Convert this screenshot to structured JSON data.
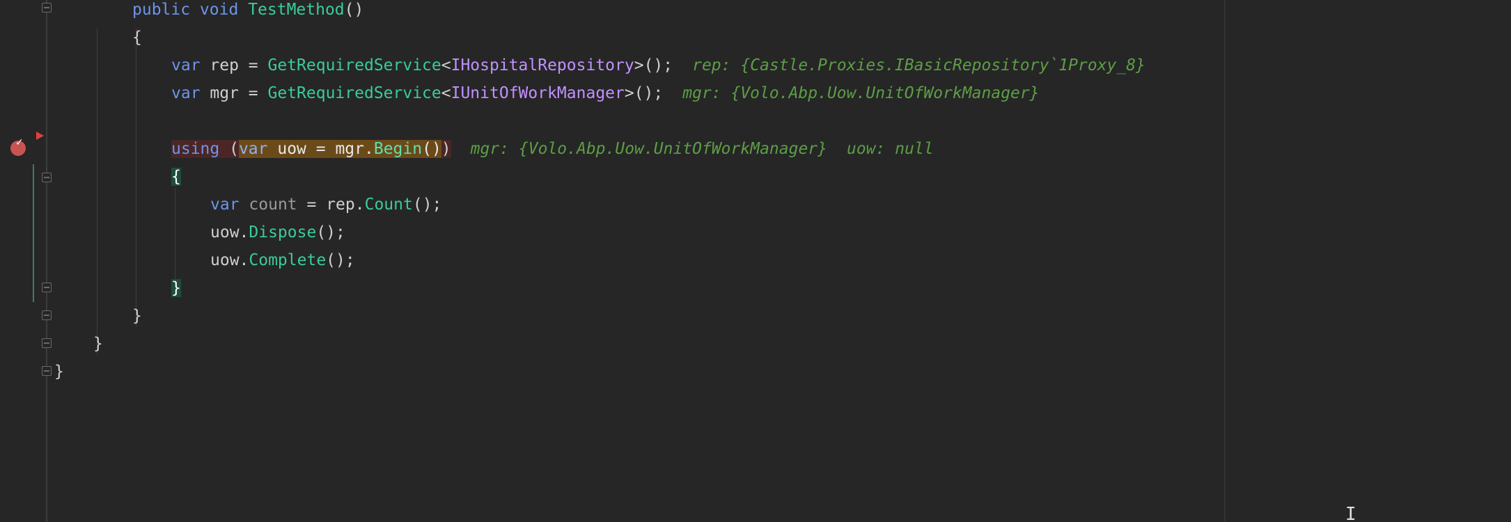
{
  "code": {
    "method_modifiers": "public void",
    "method_name": "TestMethod",
    "method_parens": "()",
    "open_brace": "{",
    "close_brace": "}",
    "kw_var": "var",
    "kw_using": "using",
    "rep_decl": {
      "name": "rep",
      "assign": " = ",
      "call": "GetRequiredService",
      "type_open": "<",
      "type": "IHospitalRepository",
      "type_close": ">();",
      "hint": "rep: {Castle.Proxies.IBasicRepository`1Proxy_8}"
    },
    "mgr_decl": {
      "name": "mgr",
      "assign": " = ",
      "call": "GetRequiredService",
      "type_open": "<",
      "type": "IUnitOfWorkManager",
      "type_close": ">();",
      "hint": "mgr: {Volo.Abp.Uow.UnitOfWorkManager}"
    },
    "using_stmt": {
      "open_paren": " (",
      "decl": "uow = mgr.",
      "call": "Begin",
      "call_parens": "()",
      "close_paren": ")",
      "hint_mgr": "mgr: {Volo.Abp.Uow.UnitOfWorkManager}",
      "hint_uow": "uow: null"
    },
    "count_decl": {
      "name": "count",
      "assign": " = rep.",
      "call": "Count",
      "end": "();"
    },
    "dispose": {
      "obj": "uow.",
      "call": "Dispose",
      "end": "();"
    },
    "complete": {
      "obj": "uow.",
      "call": "Complete",
      "end": "();"
    }
  },
  "colors": {
    "background": "#262626",
    "keyword": "#6c95eb",
    "method": "#39cc9b",
    "interface": "#c191ff",
    "inlay_hint": "#5c9e46",
    "breakpoint": "#c75450"
  },
  "icons": {
    "breakpoint": "breakpoint-icon",
    "execution_pointer": "execution-pointer-icon",
    "fold": "fold-marker-icon",
    "cursor": "text-cursor-icon"
  }
}
